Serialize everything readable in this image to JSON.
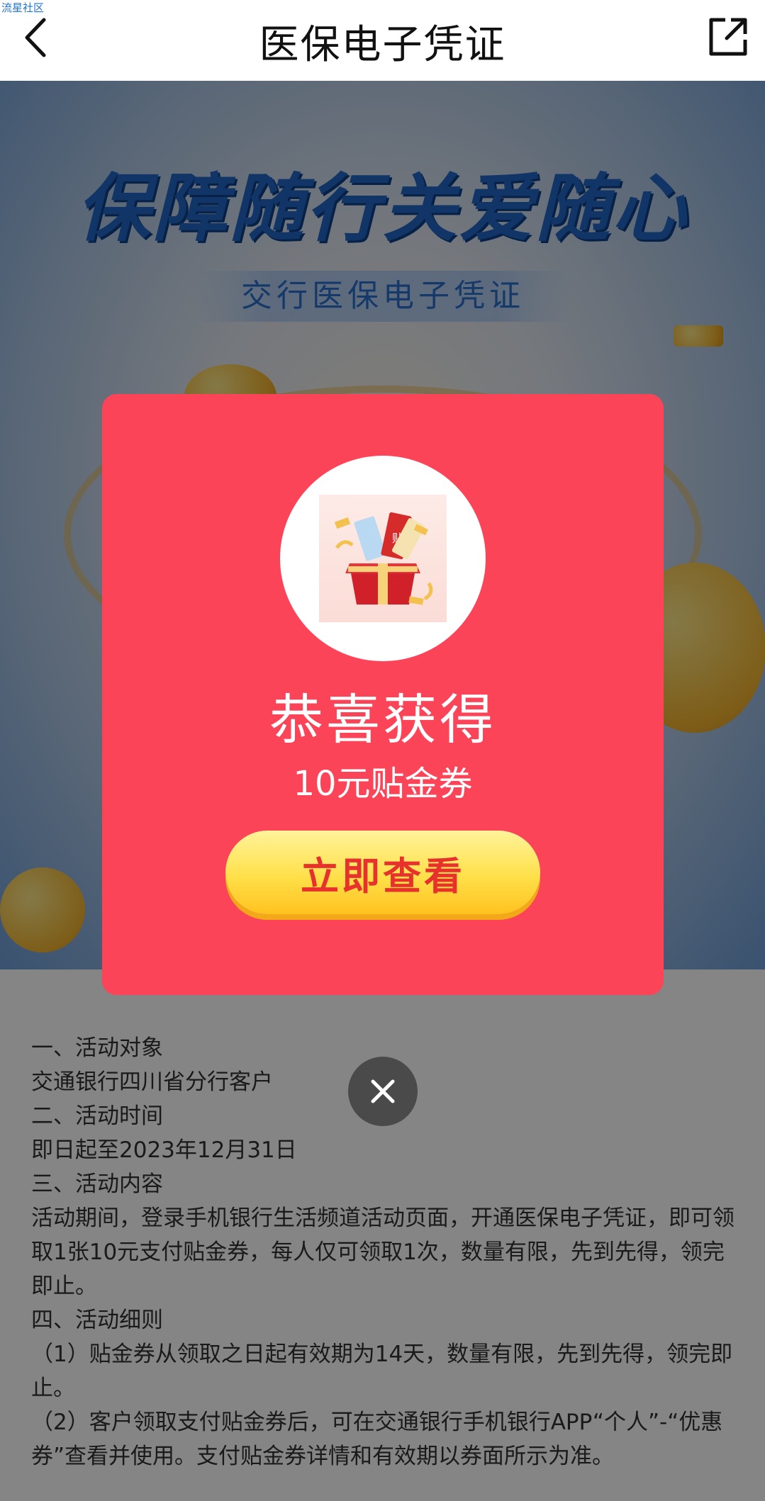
{
  "header": {
    "watermark": "流星社区",
    "title": "医保电子凭证",
    "back_icon": "chevron-left-icon",
    "share_icon": "external-link-icon"
  },
  "banner": {
    "headline": "保障随行关爱随心",
    "subtitle": "交行医保电子凭证"
  },
  "modal": {
    "title": "恭喜获得",
    "reward": "10元贴金券",
    "button_label": "立即查看",
    "gift_icon": "gift-box-icon",
    "gift_tag": "贴",
    "background_color": "#fc4459",
    "button_text_color": "#e8302c"
  },
  "close_button": {
    "icon": "close-icon"
  },
  "rules": {
    "lines": [
      "一、活动对象",
      "交通银行四川省分行客户",
      "二、活动时间",
      "即日起至2023年12月31日",
      "三、活动内容",
      "活动期间，登录手机银行生活频道活动页面，开通医保电子凭证，即可领取1张10元支付贴金券，每人仅可领取1次，数量有限，先到先得，领完即止。",
      "四、活动细则",
      "（1）贴金券从领取之日起有效期为14天，数量有限，先到先得，领完即止。",
      "（2）客户领取支付贴金券后，可在交通银行手机银行APP“个人”-“优惠券”查看并使用。支付贴金券详情和有效期以券面所示为准。"
    ]
  }
}
